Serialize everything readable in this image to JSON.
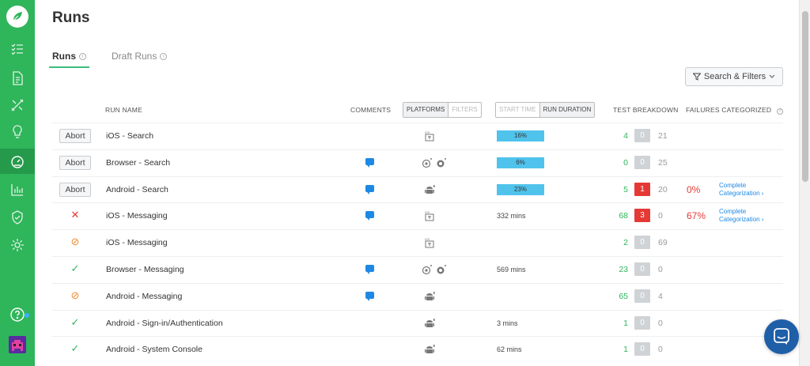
{
  "nav": {
    "items": [
      "test-cases",
      "documents",
      "tools",
      "ideas",
      "dashboard",
      "reports",
      "security",
      "settings",
      "help"
    ]
  },
  "page": {
    "title": "Runs"
  },
  "tabs": [
    {
      "label": "Runs"
    },
    {
      "label": "Draft Runs"
    }
  ],
  "search_filters": {
    "label": "Search & Filters"
  },
  "columns": {
    "run_name": "RUN NAME",
    "comments": "COMMENTS",
    "platforms": "PLATFORMS",
    "filters": "FILTERS",
    "start_time": "START TIME",
    "run_duration": "RUN DURATION",
    "test_breakdown": "TEST BREAKDOWN",
    "failures_categorized": "FAILURES CATEGORIZED"
  },
  "abort_label": "Abort",
  "rows": [
    {
      "status": "running",
      "name": "iOS - Search",
      "comment": false,
      "platforms": [
        "ios"
      ],
      "progress": 0.16,
      "progress_label": "16%",
      "duration": "",
      "pass": "4",
      "fail": "0",
      "skip": "21",
      "fail_pct": "",
      "categorization": ""
    },
    {
      "status": "running",
      "name": "Browser - Search",
      "comment": true,
      "platforms": [
        "chrome",
        "firefox"
      ],
      "progress": 0.06,
      "progress_label": "6%",
      "duration": "",
      "pass": "0",
      "fail": "0",
      "skip": "25",
      "fail_pct": "",
      "categorization": ""
    },
    {
      "status": "running",
      "name": "Android - Search",
      "comment": true,
      "platforms": [
        "android"
      ],
      "progress": 0.23,
      "progress_label": "23%",
      "duration": "",
      "pass": "5",
      "fail": "1",
      "skip": "20",
      "fail_pct": "0%",
      "categorization": "Complete Categorization ›"
    },
    {
      "status": "failed",
      "name": "iOS - Messaging",
      "comment": true,
      "platforms": [
        "ios"
      ],
      "progress": null,
      "progress_label": "",
      "duration": "332 mins",
      "pass": "68",
      "fail": "3",
      "skip": "0",
      "fail_pct": "67%",
      "categorization": "Complete Categorization ›"
    },
    {
      "status": "aborted",
      "name": "iOS - Messaging",
      "comment": false,
      "platforms": [
        "ios"
      ],
      "progress": null,
      "progress_label": "",
      "duration": "",
      "pass": "2",
      "fail": "0",
      "skip": "69",
      "fail_pct": "",
      "categorization": ""
    },
    {
      "status": "passed",
      "name": "Browser - Messaging",
      "comment": true,
      "platforms": [
        "chrome",
        "firefox"
      ],
      "progress": null,
      "progress_label": "",
      "duration": "569 mins",
      "pass": "23",
      "fail": "0",
      "skip": "0",
      "fail_pct": "",
      "categorization": ""
    },
    {
      "status": "aborted",
      "name": "Android - Messaging",
      "comment": true,
      "platforms": [
        "android"
      ],
      "progress": null,
      "progress_label": "",
      "duration": "",
      "pass": "65",
      "fail": "0",
      "skip": "4",
      "fail_pct": "",
      "categorization": ""
    },
    {
      "status": "passed",
      "name": "Android - Sign-in/Authentication",
      "comment": false,
      "platforms": [
        "android"
      ],
      "progress": null,
      "progress_label": "",
      "duration": "3 mins",
      "pass": "1",
      "fail": "0",
      "skip": "0",
      "fail_pct": "",
      "categorization": ""
    },
    {
      "status": "passed",
      "name": "Android - System Console",
      "comment": false,
      "platforms": [
        "android"
      ],
      "progress": null,
      "progress_label": "",
      "duration": "62 mins",
      "pass": "1",
      "fail": "0",
      "skip": "0",
      "fail_pct": "",
      "categorization": ""
    }
  ],
  "colors": {
    "sidebar": "#2fb55a",
    "pass": "#2fb55a",
    "fail": "#e53935",
    "progress": "#4fc3ec",
    "link": "#1e88e5",
    "aborted": "#f08c2e"
  }
}
